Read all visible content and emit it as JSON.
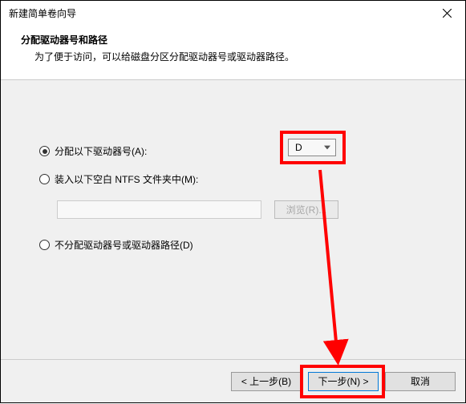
{
  "window": {
    "title": "新建简单卷向导"
  },
  "header": {
    "main": "分配驱动器号和路径",
    "sub": "为了便于访问，可以给磁盘分区分配驱动器号或驱动器路径。"
  },
  "options": {
    "assign": "分配以下驱动器号(A):",
    "mount": "装入以下空白 NTFS 文件夹中(M):",
    "none": "不分配驱动器号或驱动器路径(D)"
  },
  "drive": {
    "selected": "D"
  },
  "browse": {
    "label": "浏览(R)..."
  },
  "buttons": {
    "back": "< 上一步(B)",
    "next": "下一步(N) >",
    "cancel": "取消"
  }
}
